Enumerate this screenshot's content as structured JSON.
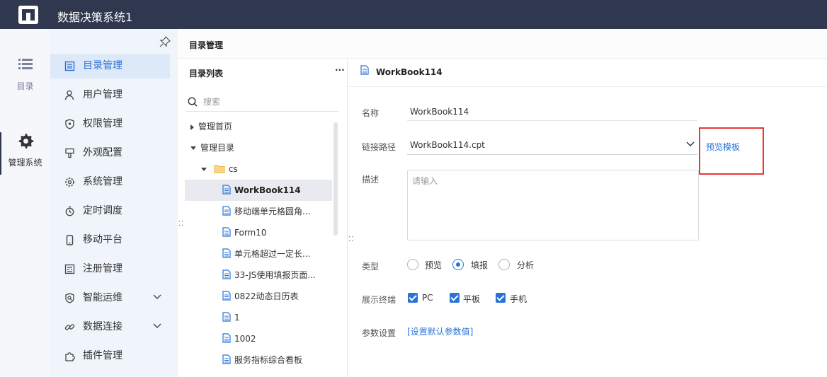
{
  "header": {
    "title": "数据决策系统1"
  },
  "iconbar": {
    "items": [
      {
        "label": "目录",
        "icon": "list-icon"
      },
      {
        "label": "管理系统",
        "icon": "gear-icon"
      }
    ]
  },
  "menu": {
    "items": [
      {
        "label": "目录管理",
        "icon": "catalog-icon"
      },
      {
        "label": "用户管理",
        "icon": "user-icon"
      },
      {
        "label": "权限管理",
        "icon": "shield-icon"
      },
      {
        "label": "外观配置",
        "icon": "brush-icon"
      },
      {
        "label": "系统管理",
        "icon": "settings-icon"
      },
      {
        "label": "定时调度",
        "icon": "timer-icon"
      },
      {
        "label": "移动平台",
        "icon": "mobile-icon"
      },
      {
        "label": "注册管理",
        "icon": "register-icon"
      },
      {
        "label": "智能运维",
        "icon": "ops-icon"
      },
      {
        "label": "数据连接",
        "icon": "link-icon"
      },
      {
        "label": "插件管理",
        "icon": "plugin-icon"
      }
    ]
  },
  "breadcrumb": "目录管理",
  "directory": {
    "title": "目录列表",
    "more": "···",
    "search_placeholder": "搜索",
    "tree": [
      {
        "label": "管理首页"
      },
      {
        "label": "管理目录"
      },
      {
        "label": "cs"
      },
      {
        "label": "WorkBook114"
      },
      {
        "label": "移动端单元格圆角..."
      },
      {
        "label": "Form10"
      },
      {
        "label": "单元格超过一定长..."
      },
      {
        "label": "33-JS使用填报页面..."
      },
      {
        "label": "0822动态日历表"
      },
      {
        "label": "1"
      },
      {
        "label": "1002"
      },
      {
        "label": "服务指标综合看板"
      }
    ]
  },
  "detail": {
    "title": "WorkBook114",
    "name_label": "名称",
    "name_value": "WorkBook114",
    "path_label": "链接路径",
    "path_value": "WorkBook114.cpt",
    "preview_link": "预览模板",
    "desc_label": "描述",
    "desc_placeholder": "请输入",
    "type_label": "类型",
    "types": [
      "预览",
      "填报",
      "分析"
    ],
    "terminal_label": "展示终端",
    "terminals": [
      "PC",
      "平板",
      "手机"
    ],
    "param_label": "参数设置",
    "param_link": "[设置默认参数值]"
  },
  "colors": {
    "header": "#30384f",
    "accent": "#2872d8",
    "highlight_box": "#e53935"
  }
}
